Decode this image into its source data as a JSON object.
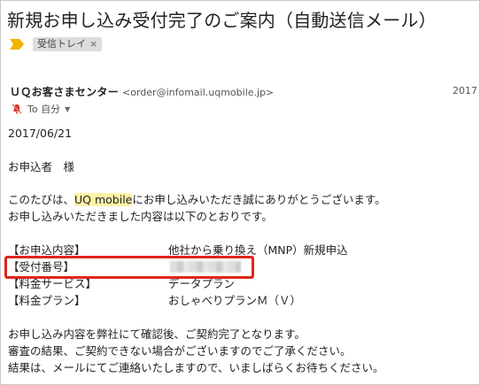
{
  "email": {
    "subject": "新規お申し込み受付完了のご案内（自動送信メール）",
    "label_chip": "受信トレイ",
    "label_chip_close": "×",
    "sender_name": "ＵＱお客さまセンター",
    "sender_email": "<order@infomail.uqmobile.jp>",
    "received_date_partial": "2017",
    "to_text": "To 自分",
    "to_chevron": "▼"
  },
  "body": {
    "date": "2017/06/21",
    "greeting": "お申込者　様",
    "intro_pre": "このたびは、",
    "intro_highlight": "UQ mobile",
    "intro_post": "にお申し込みいただき誠にありがとうございます。",
    "intro_line2": "お申し込みいただきました内容は以下のとおりです。",
    "table": [
      {
        "key": "【お申込内容】",
        "value": "他社から乗り換え（MNP）新規申込"
      },
      {
        "key": "【受付番号】",
        "value": ""
      },
      {
        "key": "【料金サービス】",
        "value": "データプラン"
      },
      {
        "key": "【料金プラン】",
        "value": "おしゃべりプランＭ（Ｖ）"
      }
    ],
    "closing_1": "お申し込み内容を弊社にて確認後、ご契約完了となります。",
    "closing_2": "審査の結果、ご契約できない場合がございますのでご了承ください。",
    "closing_3": "結果は、メールにてご連絡いたしますので、いましばらくお待ちください。"
  },
  "colors": {
    "highlight_box": "#e1251b",
    "importance_marker": "#f2b400",
    "mute_icon": "#d93025",
    "text_highlight": "#fff3a8"
  },
  "icons": {
    "importance": "importance-marker-icon",
    "notification_off": "bell-off-icon",
    "dropdown": "chevron-down-icon"
  }
}
